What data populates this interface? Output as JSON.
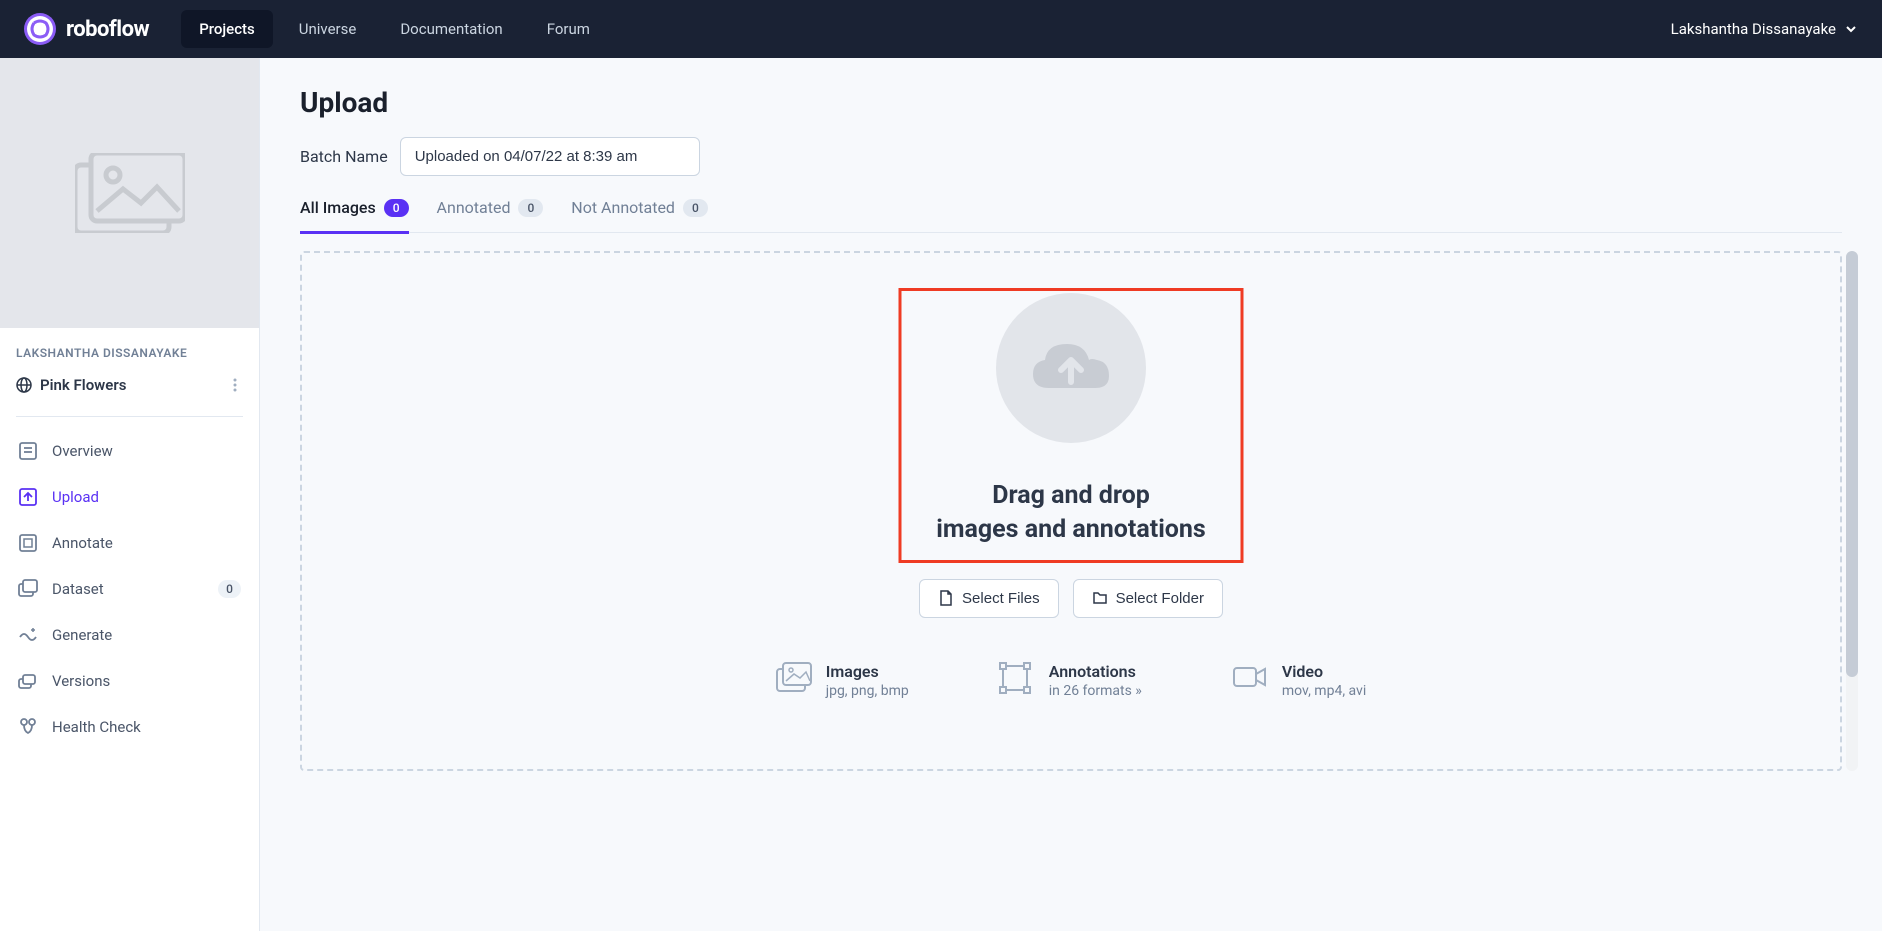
{
  "brand": "roboflow",
  "nav": {
    "items": [
      "Projects",
      "Universe",
      "Documentation",
      "Forum"
    ],
    "active_index": 0
  },
  "user": {
    "name": "Lakshantha Dissanayake"
  },
  "sidebar": {
    "workspace": "LAKSHANTHA DISSANAYAKE",
    "project": "Pink Flowers",
    "menu": [
      {
        "label": "Overview"
      },
      {
        "label": "Upload",
        "active": true
      },
      {
        "label": "Annotate"
      },
      {
        "label": "Dataset",
        "badge": "0"
      },
      {
        "label": "Generate"
      },
      {
        "label": "Versions"
      },
      {
        "label": "Health Check"
      }
    ]
  },
  "page": {
    "title": "Upload",
    "batch_label": "Batch Name",
    "batch_value": "Uploaded on 04/07/22 at 8:39 am",
    "tabs": [
      {
        "label": "All Images",
        "count": "0",
        "active": true
      },
      {
        "label": "Annotated",
        "count": "0"
      },
      {
        "label": "Not Annotated",
        "count": "0"
      }
    ],
    "dropzone": {
      "line1": "Drag and drop",
      "line2": "images and annotations",
      "select_files": "Select Files",
      "select_folder": "Select Folder"
    },
    "formats": [
      {
        "title": "Images",
        "sub": "jpg, png, bmp"
      },
      {
        "title": "Annotations",
        "sub": "in 26 formats »"
      },
      {
        "title": "Video",
        "sub": "mov, mp4, avi"
      }
    ]
  }
}
